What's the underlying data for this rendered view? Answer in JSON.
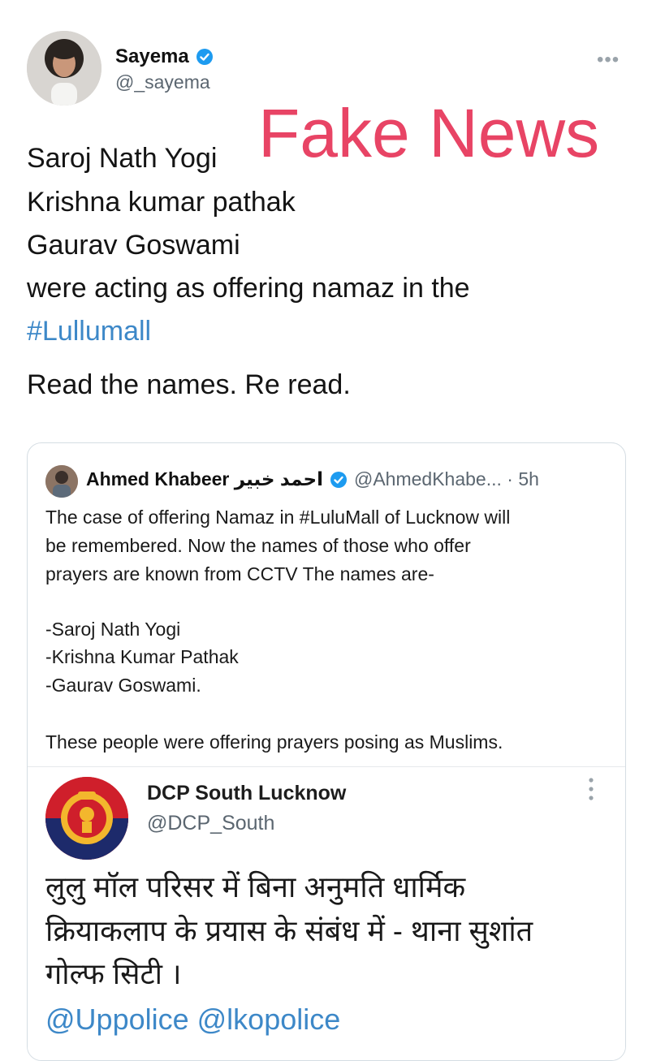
{
  "tweet": {
    "author_name": "Sayema",
    "author_handle": "@_sayema",
    "more_icon": "more-horizontal-icon",
    "overlay_stamp": "Fake News",
    "lines": [
      "Saroj Nath Yogi",
      "Krishna kumar pathak",
      "Gaurav Goswami",
      "were acting as offering namaz in the"
    ],
    "hashtag": "#Lullumall",
    "closing_line": "Read the names. Re read."
  },
  "quoted_tweet": {
    "author_name": "Ahmed Khabeer احمد خبیر",
    "author_handle_time": "@AhmedKhabe... · 5h",
    "lines": [
      "The case of offering Namaz in #LuluMall of Lucknow will",
      "be remembered. Now the names of those who offer",
      "prayers are known from CCTV The names are-",
      "-Saroj Nath Yogi",
      "-Krishna Kumar Pathak",
      "-Gaurav Goswami.",
      "These people were offering prayers posing as Muslims."
    ]
  },
  "embedded_tweet": {
    "author_name": "DCP South Lucknow",
    "author_handle": "@DCP_South",
    "hindi_lines": [
      "लुलु मॉल परिसर में बिना अनुमति धार्मिक",
      "क्रियाकलाप के प्रयास के संबंध में - थाना सुशांत",
      "गोल्फ सिटी ।"
    ],
    "mentions": "@Uppolice @lkopolice"
  },
  "colors": {
    "verified": "#1d9bf0",
    "stamp": "#e84465",
    "link": "#3d88c8"
  }
}
